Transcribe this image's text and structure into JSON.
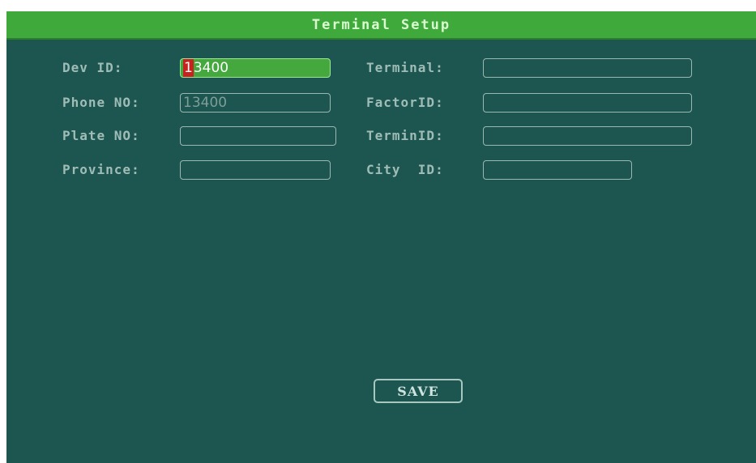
{
  "window": {
    "title": "Terminal Setup"
  },
  "form": {
    "dev_id": {
      "label": "Dev ID:",
      "value_first": "1",
      "value_rest": "3400"
    },
    "phone_no": {
      "label": "Phone NO:",
      "value": "13400"
    },
    "plate_no": {
      "label": "Plate NO:",
      "value": ""
    },
    "province": {
      "label": "Province:",
      "value": ""
    },
    "terminal": {
      "label": "Terminal:",
      "value": ""
    },
    "factor_id": {
      "label": "FactorID:",
      "value": ""
    },
    "termin_id": {
      "label": "TerminID:",
      "value": ""
    },
    "city_id": {
      "label": "City  ID:",
      "value": ""
    }
  },
  "actions": {
    "save_label": "SAVE"
  },
  "colors": {
    "background": "#1d5650",
    "titlebar": "#3fa93c",
    "active_field": "#45a83f",
    "cursor": "#c8221e"
  }
}
